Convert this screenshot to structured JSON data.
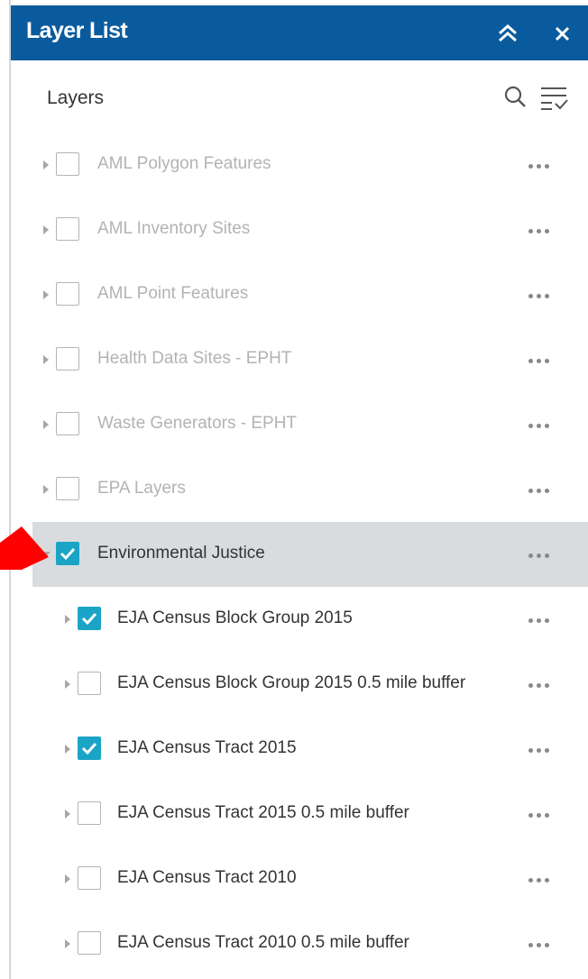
{
  "panel": {
    "title": "Layer List",
    "collapse_icon": "double-chevron-up-icon",
    "close_icon": "close-icon"
  },
  "toolbar": {
    "title": "Layers",
    "search_icon": "search-icon",
    "options_icon": "filter-list-icon"
  },
  "colors": {
    "header_bg": "#0a5b9e",
    "checkbox_checked": "#1aa4c6",
    "selected_row_bg": "#d9dcdf",
    "annotation_arrow": "#ff0000"
  },
  "layers": [
    {
      "label": "AML Polygon Features",
      "checked": false,
      "dimmed": true,
      "level": 0,
      "expanded": false
    },
    {
      "label": "AML Inventory Sites",
      "checked": false,
      "dimmed": true,
      "level": 0,
      "expanded": false
    },
    {
      "label": "AML Point Features",
      "checked": false,
      "dimmed": true,
      "level": 0,
      "expanded": false
    },
    {
      "label": "Health Data Sites - EPHT",
      "checked": false,
      "dimmed": true,
      "level": 0,
      "expanded": false
    },
    {
      "label": "Waste Generators - EPHT",
      "checked": false,
      "dimmed": true,
      "level": 0,
      "expanded": false
    },
    {
      "label": "EPA Layers",
      "checked": false,
      "dimmed": true,
      "level": 0,
      "expanded": false
    },
    {
      "label": "Environmental Justice",
      "checked": true,
      "dimmed": false,
      "level": 0,
      "expanded": true,
      "selected": true
    },
    {
      "label": "EJA Census Block Group 2015",
      "checked": true,
      "dimmed": false,
      "level": 1,
      "expanded": false
    },
    {
      "label": "EJA Census Block Group 2015 0.5 mile buffer",
      "checked": false,
      "dimmed": false,
      "level": 1,
      "expanded": false
    },
    {
      "label": "EJA Census Tract 2015",
      "checked": true,
      "dimmed": false,
      "level": 1,
      "expanded": false
    },
    {
      "label": "EJA Census Tract 2015 0.5 mile buffer",
      "checked": false,
      "dimmed": false,
      "level": 1,
      "expanded": false
    },
    {
      "label": "EJA Census Tract 2010",
      "checked": false,
      "dimmed": false,
      "level": 1,
      "expanded": false
    },
    {
      "label": "EJA Census Tract 2010 0.5 mile buffer",
      "checked": false,
      "dimmed": false,
      "level": 1,
      "expanded": false
    }
  ]
}
